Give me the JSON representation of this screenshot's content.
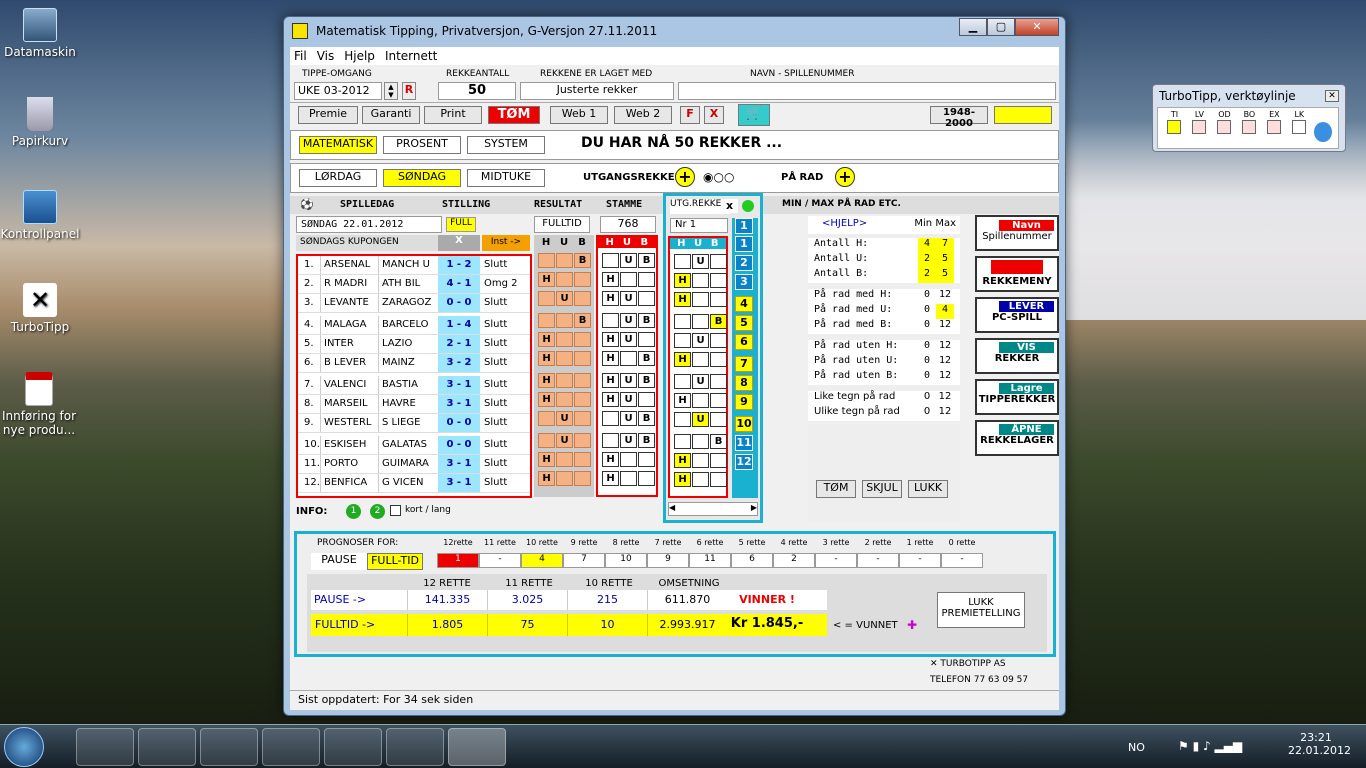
{
  "desktop": {
    "icons": [
      {
        "label": "Datamaskin",
        "icon": "computer-icon"
      },
      {
        "label": "Papirkurv",
        "icon": "recycle-bin-icon"
      },
      {
        "label": "Kontrollpanel",
        "icon": "control-panel-icon"
      },
      {
        "label": "TurboTipp",
        "icon": "turbotipp-icon"
      },
      {
        "label": "Innføring for nye produ...",
        "icon": "pdf-icon"
      }
    ]
  },
  "window": {
    "title": "Matematisk Tipping, Privatversjon, G-Versjon 27.11.2011"
  },
  "menu": [
    "Fil",
    "Vis",
    "Hjelp",
    "Internett"
  ],
  "top": {
    "omgang_label": "TIPPE-OMGANG",
    "omgang_value": "UKE 03-2012",
    "omgang_r": "R",
    "rekkeantall_label": "REKKEANTALL",
    "rekkeantall_value": "50",
    "laget_label": "REKKENE ER LAGET MED",
    "laget_value": "Justerte rekker",
    "navn_label": "NAVN  -  SPILLENUMMER"
  },
  "toolbar": {
    "premie": "Premie",
    "garanti": "Garanti",
    "print": "Print",
    "tom": "TØM",
    "web1": "Web 1",
    "web2": "Web 2",
    "f": "F",
    "x": "X",
    "years": "1948-2000"
  },
  "modes": {
    "matematisk": "MATEMATISK",
    "prosent": "PROSENT",
    "system": "SYSTEM",
    "banner": "DU HAR NÅ  50  REKKER ...",
    "lordag": "LØRDAG",
    "sondag": "SØNDAG",
    "midtuke": "MIDTUKE",
    "utgang": "UTGANGSREKKER",
    "pa_rad": "PÅ RAD"
  },
  "grid": {
    "h_spilledag": "SPILLEDAG",
    "h_stilling": "STILLING",
    "h_resultat": "RESULTAT",
    "h_stamme": "STAMME",
    "h_utg": "UTG.REKKE",
    "h_minmax": "MIN / MAX PÅ RAD ETC.",
    "date": "SØNDAG 22.01.2012",
    "full": "FULL",
    "fulltid": "FULLTID",
    "stamme_count": "768",
    "nr": "Nr 1",
    "kupong": "SØNDAGS KUPONGEN",
    "x_col": "X",
    "inst": "Inst ->",
    "hub": [
      "H",
      "U",
      "B"
    ],
    "matches": [
      {
        "n": "1.",
        "home": "ARSENAL",
        "away": "MANCH U",
        "score": "1 - 2",
        "status": "Slutt",
        "res": [
          "",
          "",
          "B"
        ],
        "stamme": [
          "",
          "U",
          "B"
        ],
        "utg": [
          "",
          "U",
          ""
        ],
        "num": "1"
      },
      {
        "n": "2.",
        "home": "R MADRI",
        "away": "ATH BIL",
        "score": "4 - 1",
        "status": "Omg 2",
        "res": [
          "H",
          "",
          ""
        ],
        "stamme": [
          "H",
          "",
          ""
        ],
        "utg": [
          "H",
          "",
          ""
        ],
        "num": "2"
      },
      {
        "n": "3.",
        "home": "LEVANTE",
        "away": "ZARAGOZ",
        "score": "0 - 0",
        "status": "Slutt",
        "res": [
          "",
          "U",
          ""
        ],
        "stamme": [
          "H",
          "U",
          ""
        ],
        "utg": [
          "H",
          "",
          ""
        ],
        "num": "3"
      },
      {
        "n": "4.",
        "home": "MALAGA",
        "away": "BARCELO",
        "score": "1 - 4",
        "status": "Slutt",
        "res": [
          "",
          "",
          "B"
        ],
        "stamme": [
          "",
          "U",
          "B"
        ],
        "utg": [
          "",
          "",
          "B"
        ],
        "num": "4"
      },
      {
        "n": "5.",
        "home": "INTER",
        "away": "LAZIO",
        "score": "2 - 1",
        "status": "Slutt",
        "res": [
          "H",
          "",
          ""
        ],
        "stamme": [
          "H",
          "U",
          ""
        ],
        "utg": [
          "",
          "U",
          ""
        ],
        "num": "5"
      },
      {
        "n": "6.",
        "home": "B LEVER",
        "away": "MAINZ",
        "score": "3 - 2",
        "status": "Slutt",
        "res": [
          "H",
          "",
          ""
        ],
        "stamme": [
          "H",
          "",
          "B"
        ],
        "utg": [
          "H",
          "",
          ""
        ],
        "num": "6"
      },
      {
        "n": "7.",
        "home": "VALENCI",
        "away": "BASTIA",
        "score": "3 - 1",
        "status": "Slutt",
        "res": [
          "H",
          "",
          ""
        ],
        "stamme": [
          "H",
          "U",
          "B"
        ],
        "utg": [
          "",
          "U",
          ""
        ],
        "num": "7"
      },
      {
        "n": "8.",
        "home": "MARSEIL",
        "away": "HAVRE",
        "score": "3 - 1",
        "status": "Slutt",
        "res": [
          "H",
          "",
          ""
        ],
        "stamme": [
          "H",
          "U",
          ""
        ],
        "utg": [
          "H",
          "",
          ""
        ],
        "num": "8"
      },
      {
        "n": "9.",
        "home": "WESTERL",
        "away": "S LIEGE",
        "score": "0 - 0",
        "status": "Slutt",
        "res": [
          "",
          "U",
          ""
        ],
        "stamme": [
          "",
          "U",
          "B"
        ],
        "utg": [
          "",
          "U",
          ""
        ],
        "num": "9"
      },
      {
        "n": "10.",
        "home": "ESKISEH",
        "away": "GALATAS",
        "score": "0 - 0",
        "status": "Slutt",
        "res": [
          "",
          "U",
          ""
        ],
        "stamme": [
          "",
          "U",
          "B"
        ],
        "utg": [
          "",
          "",
          "B"
        ],
        "num": "10"
      },
      {
        "n": "11.",
        "home": "PORTO",
        "away": "GUIMARA",
        "score": "3 - 1",
        "status": "Slutt",
        "res": [
          "H",
          "",
          ""
        ],
        "stamme": [
          "H",
          "",
          ""
        ],
        "utg": [
          "H",
          "",
          ""
        ],
        "num": "11"
      },
      {
        "n": "12.",
        "home": "BENFICA",
        "away": "G VICEN",
        "score": "3 - 1",
        "status": "Slutt",
        "res": [
          "H",
          "",
          ""
        ],
        "stamme": [
          "H",
          "",
          ""
        ],
        "utg": [
          "H",
          "",
          ""
        ],
        "num": "12"
      }
    ]
  },
  "minmax": {
    "hjelp": "<HJELP>",
    "min": "Min",
    "max": "Max",
    "rows1": [
      {
        "l": "Antall H:",
        "a": "4",
        "b": "7"
      },
      {
        "l": "Antall U:",
        "a": "2",
        "b": "5"
      },
      {
        "l": "Antall B:",
        "a": "2",
        "b": "5"
      }
    ],
    "rows2": [
      {
        "l": "På rad med H:",
        "a": "0",
        "b": "12"
      },
      {
        "l": "På rad med U:",
        "a": "0",
        "b": "4"
      },
      {
        "l": "På rad med B:",
        "a": "0",
        "b": "12"
      }
    ],
    "rows3": [
      {
        "l": "På rad uten H:",
        "a": "0",
        "b": "12"
      },
      {
        "l": "På rad uten U:",
        "a": "0",
        "b": "12"
      },
      {
        "l": "På rad uten B:",
        "a": "0",
        "b": "12"
      }
    ],
    "rows4": [
      {
        "l": "Like tegn på rad",
        "a": "0",
        "b": "12"
      },
      {
        "l": "Ulike tegn på rad",
        "a": "0",
        "b": "12"
      }
    ],
    "tom": "TØM",
    "skjul": "SKJUL",
    "lukk": "LUKK"
  },
  "side": {
    "navn": "Navn",
    "spillenummer": "Spillenummer",
    "rekkemeny": "REKKEMENY",
    "lever": "LEVER",
    "pcspill": "PC-SPILL",
    "vis": "VIS",
    "rekker": "REKKER",
    "lagre": "Lagre",
    "tipperekker": "TIPPEREKKER",
    "apne": "ÅPNE",
    "rekkelager": "REKKELAGER"
  },
  "info": {
    "label": "INFO:",
    "b1": "1",
    "b2": "2",
    "kort": "kort / lang"
  },
  "prognose": {
    "label": "PROGNOSER FOR:",
    "pause": "PAUSE",
    "fulltid": "FULL-TID",
    "heads": [
      "12rette",
      "11 rette",
      "10 rette",
      "9 rette",
      "8 rette",
      "7 rette",
      "6 rette",
      "5 rette",
      "4 rette",
      "3 rette",
      "2 rette",
      "1 rette",
      "0 rette"
    ],
    "vals": [
      "1",
      "-",
      "4",
      "7",
      "10",
      "9",
      "11",
      "6",
      "2",
      "-",
      "-",
      "-",
      "-"
    ],
    "c12": "12 RETTE",
    "c11": "11 RETTE",
    "c10": "10 RETTE",
    "oms": "OMSETNING",
    "pause_row": {
      "l": "PAUSE      ->",
      "a": "141.335",
      "b": "3.025",
      "c": "215",
      "d": "611.870",
      "e": "VINNER !"
    },
    "full_row": {
      "l": "FULLTID   ->",
      "a": "1.805",
      "b": "75",
      "c": "10",
      "d": "2.993.917",
      "e": "Kr  1.845,-"
    },
    "vunnet": "< = VUNNET",
    "lukk1": "LUKK",
    "lukk2": "PREMIETELLING"
  },
  "footer": {
    "turbotipp": "TURBOTIPP AS",
    "telefon": "TELEFON  77 63 09 57",
    "status": "Sist oppdatert: For 34 sek siden"
  },
  "toolbox": {
    "title": "TurboTipp, verktøylinje",
    "labels": [
      "TI",
      "LV",
      "OD",
      "BO",
      "EX",
      "LK"
    ]
  },
  "taskbar": {
    "lang": "NO",
    "time": "23:21",
    "date": "22.01.2012"
  }
}
